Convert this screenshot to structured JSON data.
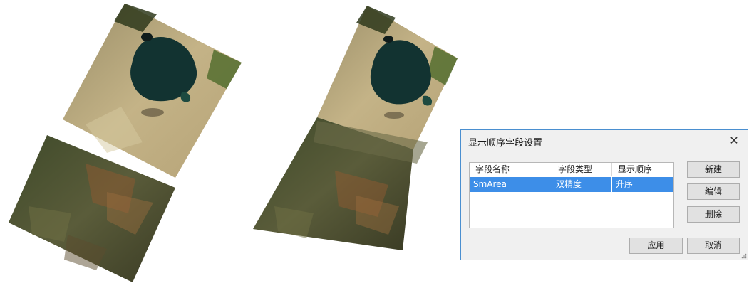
{
  "dialog": {
    "title": "显示顺序字段设置",
    "close_icon": "close-icon"
  },
  "table": {
    "columns": [
      "字段名称",
      "字段类型",
      "显示顺序"
    ],
    "rows": [
      {
        "name": "SmArea",
        "type": "双精度",
        "order": "升序",
        "selected": true
      }
    ]
  },
  "buttons": {
    "new": "新建",
    "edit": "编辑",
    "delete": "删除",
    "apply": "应用",
    "cancel": "取消"
  },
  "colors": {
    "selection": "#3d8ee8",
    "dialog_border": "#4a8fd0",
    "dialog_bg": "#f0f0f0"
  }
}
